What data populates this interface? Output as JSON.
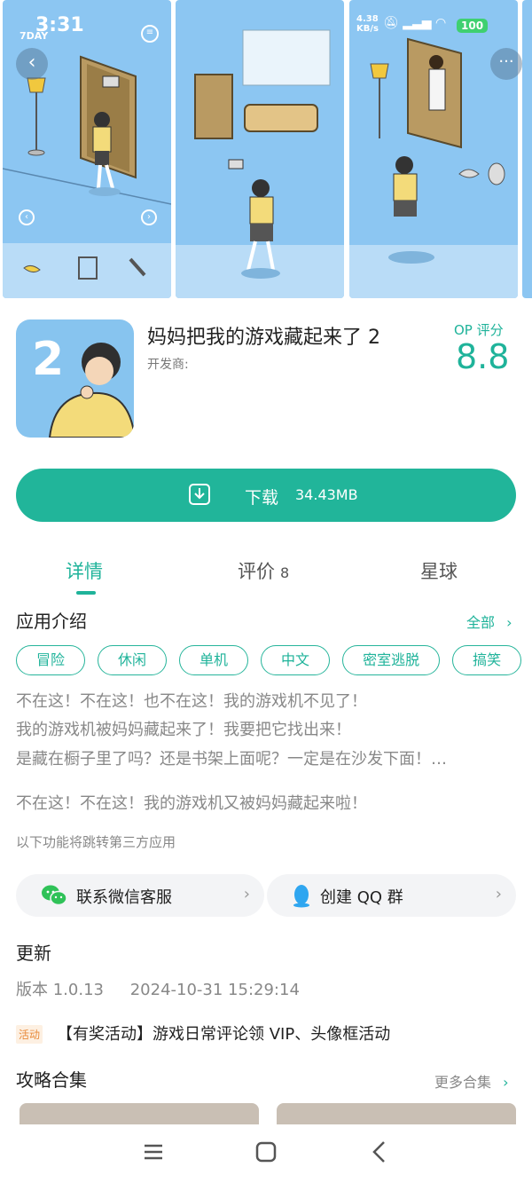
{
  "status_bar": {
    "time": "3:31",
    "day_badge": "7DAY",
    "net_speed_value": "4.38",
    "net_speed_unit": "KB/s",
    "battery": "100"
  },
  "app": {
    "icon_number": "2",
    "title": "妈妈把我的游戏藏起来了 2",
    "developer_label": "开发商:",
    "rating_label": "OP 评分",
    "rating_value": "8.8"
  },
  "download": {
    "label": "下载",
    "size": "34.43MB"
  },
  "tabs": [
    {
      "label": "详情",
      "count": ""
    },
    {
      "label": "评价",
      "count": "8"
    },
    {
      "label": "星球",
      "count": ""
    }
  ],
  "intro": {
    "title": "应用介绍",
    "all_link": "全部",
    "tags": [
      "冒险",
      "休闲",
      "单机",
      "中文",
      "密室逃脱",
      "搞笑"
    ],
    "lines": [
      "不在这！不在这！也不在这！我的游戏机不见了！",
      "我的游戏机被妈妈藏起来了！我要把它找出来！",
      "是藏在橱子里了吗？还是书架上面呢？一定是在沙发下面！…",
      "不在这！不在这！我的游戏机又被妈妈藏起来啦！"
    ],
    "third_party_note": "以下功能将跳转第三方应用"
  },
  "contacts": {
    "wechat": "联系微信客服",
    "qq": "创建 QQ 群"
  },
  "update": {
    "title": "更新",
    "version": "版本 1.0.13",
    "date": "2024-10-31 15:29:14",
    "activity_badge": "活动",
    "activity_text": "【有奖活动】游戏日常评论领 VIP、头像框活动"
  },
  "guides": {
    "title": "攻略合集",
    "more_link": "更多合集"
  },
  "colors": {
    "accent": "#21b59a",
    "sky": "#8cc6f2",
    "badge_orange": "#e88a3a"
  }
}
